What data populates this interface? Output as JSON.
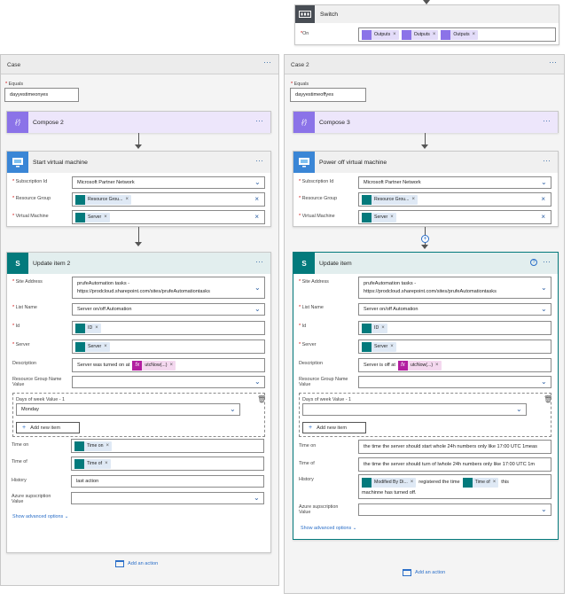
{
  "switch": {
    "title": "Switch",
    "on_label": "On",
    "outputs": [
      "Outputs",
      "Outputs",
      "Outputs"
    ]
  },
  "case1": {
    "title": "Case",
    "equals_label": "Equals",
    "equals_value": "dayyestimeonyes",
    "compose": {
      "title": "Compose 2"
    },
    "vm": {
      "title": "Start virtual machine",
      "subscription_label": "Subscription Id",
      "subscription_value": "Microsoft Partner Network",
      "rg_label": "Resource Group",
      "rg_token": "Resource Grou...",
      "vm_label": "Virtual Machine",
      "vm_token": "Server"
    },
    "update": {
      "title": "Update item 2",
      "site_label": "Site Address",
      "site_line1": "prufeAutomation tasks -",
      "site_line2": "https://prodcloud.sharepoint.com/sites/prufeAutomationtasks",
      "list_label": "List Name",
      "list_value": "Server on/off Automation",
      "id_label": "Id",
      "id_token": "ID",
      "server_label": "Server",
      "server_token": "Server",
      "desc_label": "Description",
      "desc_text": "Server was turned on at",
      "desc_fx": "utcNow(...)",
      "rgname_label1": "Resource Group Name",
      "rgname_label2": "Value",
      "days_label": "Days of week Value - 1",
      "days_value": "Monday",
      "add_new": "Add new item",
      "timeon_label": "Time on",
      "timeon_token": "Time on",
      "timeof_label": "Time of",
      "timeof_token": "Time of",
      "history_label": "History",
      "history_value": "last action",
      "azure_label1": "Azure supscription",
      "azure_label2": "Value",
      "advanced": "Show advanced options"
    },
    "add_action": "Add an action"
  },
  "case2": {
    "title": "Case 2",
    "equals_label": "Equals",
    "equals_value": "dayyestimeoffyes",
    "compose": {
      "title": "Compose 3"
    },
    "vm": {
      "title": "Power off virtual machine",
      "subscription_label": "Subscription Id",
      "subscription_value": "Microsoft Partner Network",
      "rg_label": "Resource Group",
      "rg_token": "Resource Grou...",
      "vm_label": "Virtual Machine",
      "vm_token": "Server"
    },
    "update": {
      "title": "Update item",
      "site_label": "Site Address",
      "site_line1": "prufeAutomation tasks -",
      "site_line2": "https://prodcloud.sharepoint.com/sites/prufeAutomationtasks",
      "list_label": "List Name",
      "list_value": "Server on/off Automation",
      "id_label": "Id",
      "id_token": "ID",
      "server_label": "Server",
      "server_token": "Server",
      "desc_label": "Description",
      "desc_text": "Server is off at",
      "desc_fx": "utcNow(...)",
      "rgname_label1": "Resource Group Name",
      "rgname_label2": "Value",
      "days_label": "Days of week Value - 1",
      "add_new": "Add new item",
      "timeon_label": "Time on",
      "timeon_value": "the time the server should start whole 24h numbers only like 17:00 UTC 1meas",
      "timeof_label": "Time of",
      "timeof_value": "the time the server should turn of lwhole 24h numbers only like 17:00 UTC 1m",
      "history_label": "History",
      "history_token1": "Modified By Di...",
      "history_text1": "registered the time",
      "history_token2": "Time of",
      "history_text2": "this",
      "history_line2": "machinne has turned off.",
      "azure_label1": "Azure supscription",
      "azure_label2": "Value",
      "advanced": "Show advanced options"
    },
    "add_action": "Add an action"
  },
  "colors": {
    "accent": "#2b6fc8",
    "sharepoint": "#037a7c",
    "compose": "#8b73e8",
    "vm": "#3a86d6",
    "fx": "#b21ea0"
  }
}
